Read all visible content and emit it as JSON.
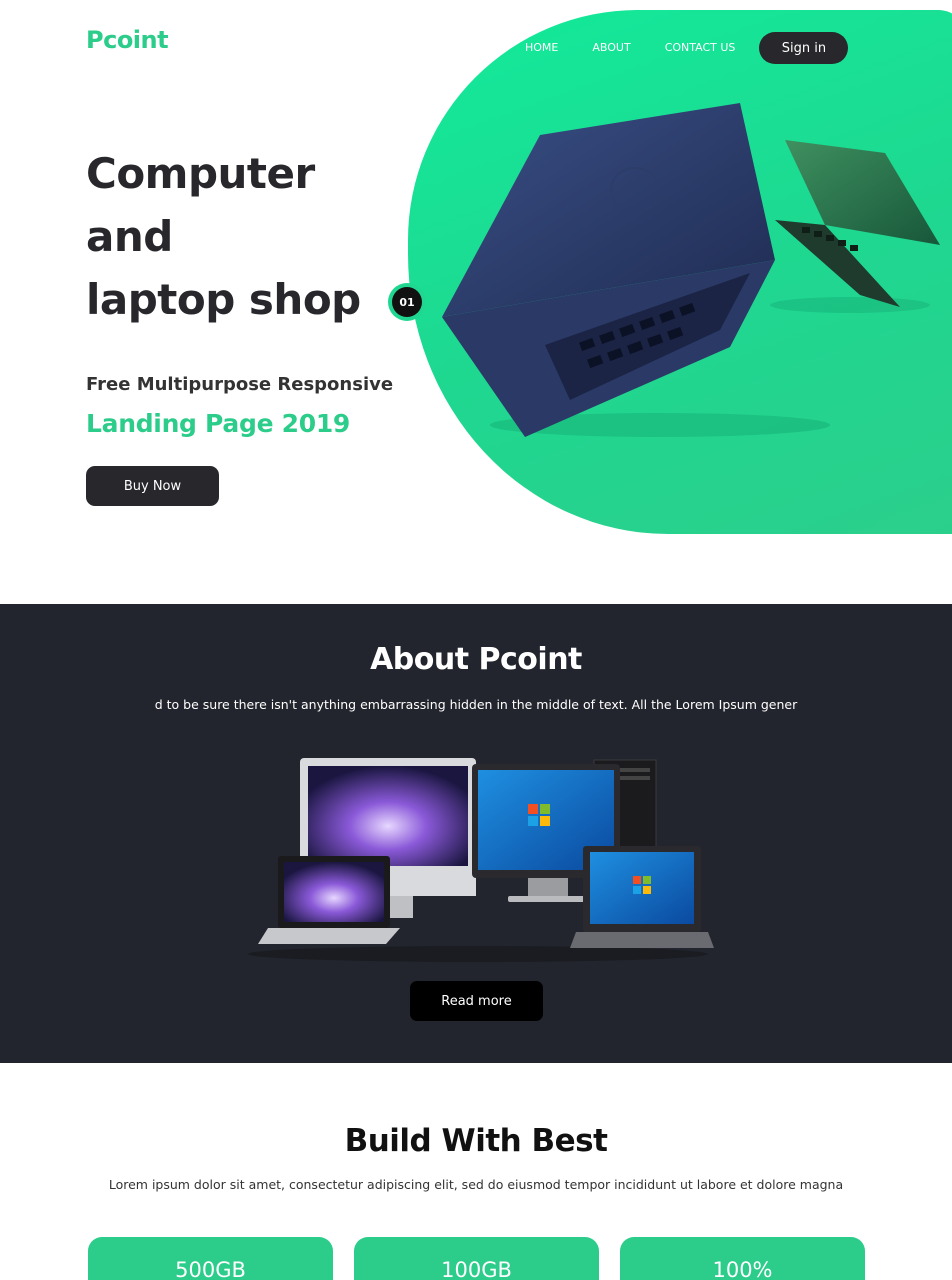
{
  "brand": "Pcoint",
  "nav": {
    "items": [
      "HOME",
      "ABOUT",
      "CONTACT US"
    ],
    "signin_label": "Sign in"
  },
  "hero": {
    "title_lines": [
      "Computer",
      "and",
      "laptop shop"
    ],
    "subtitle": "Free Multipurpose Responsive",
    "accent": "Landing Page 2019",
    "buy_label": "Buy Now",
    "slide_number": "01"
  },
  "about": {
    "title": "About Pcoint",
    "text": "d to be sure there isn't anything embarrassing hidden in the middle of text. All the Lorem Ipsum gener",
    "read_more_label": "Read more"
  },
  "build": {
    "title": "Build With Best",
    "text": "Lorem ipsum dolor sit amet, consectetur adipiscing elit, sed do eiusmod tempor incididunt ut labore et dolore magna",
    "stats": [
      "500GB",
      "100GB",
      "100%"
    ]
  },
  "colors": {
    "accent": "#2ccc8a",
    "dark": "#27272c",
    "about_bg": "#23252e"
  }
}
